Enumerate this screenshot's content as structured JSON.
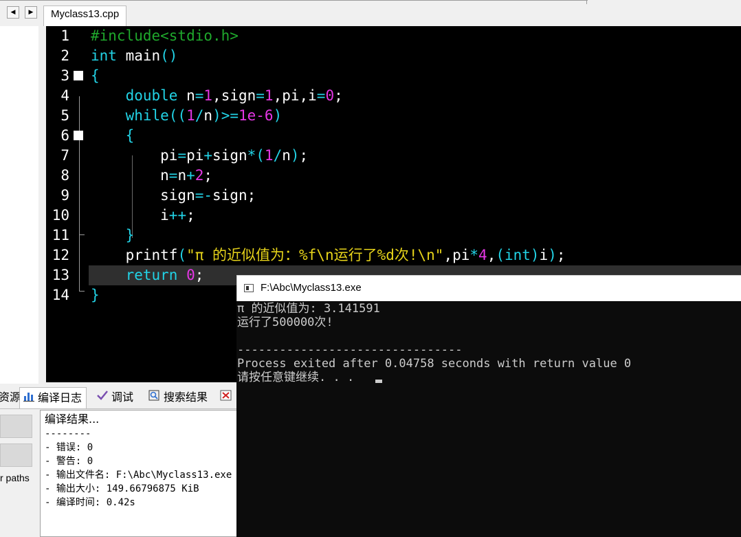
{
  "tabs": {
    "file_tab": "Myclass13.cpp",
    "nav_prev": "◀",
    "nav_next": "▶"
  },
  "editor": {
    "line_numbers": [
      "1",
      "2",
      "3",
      "4",
      "5",
      "6",
      "7",
      "8",
      "9",
      "10",
      "11",
      "12",
      "13",
      "14"
    ]
  },
  "bottom_tabs": {
    "resources_partial": "资源",
    "compile_log": "编译日志",
    "debug": "调试",
    "search_results": "搜索结果"
  },
  "left_panel": {
    "paths_partial": "r paths"
  },
  "compile_log": {
    "title": "编译结果...",
    "separator": "--------",
    "errors": "- 错误: 0",
    "warnings": "- 警告: 0",
    "output_file": "- 输出文件名: F:\\Abc\\Myclass13.exe",
    "output_size": "- 输出大小: 149.66796875 KiB",
    "compile_time": "- 编译时间: 0.42s"
  },
  "console": {
    "title": "F:\\Abc\\Myclass13.exe",
    "lines": [
      "π 的近似值为: 3.141591",
      "运行了500000次!",
      "",
      "--------------------------------",
      "Process exited after 0.04758 seconds with return value 0",
      "请按任意键继续. . . "
    ]
  },
  "colors": {
    "keyword": "#22d3e6",
    "preprocessor": "#1fa82c",
    "number": "#e536e5",
    "string": "#e7d41a",
    "editor_bg": "#000000",
    "console_bg": "#0c0c0c"
  }
}
